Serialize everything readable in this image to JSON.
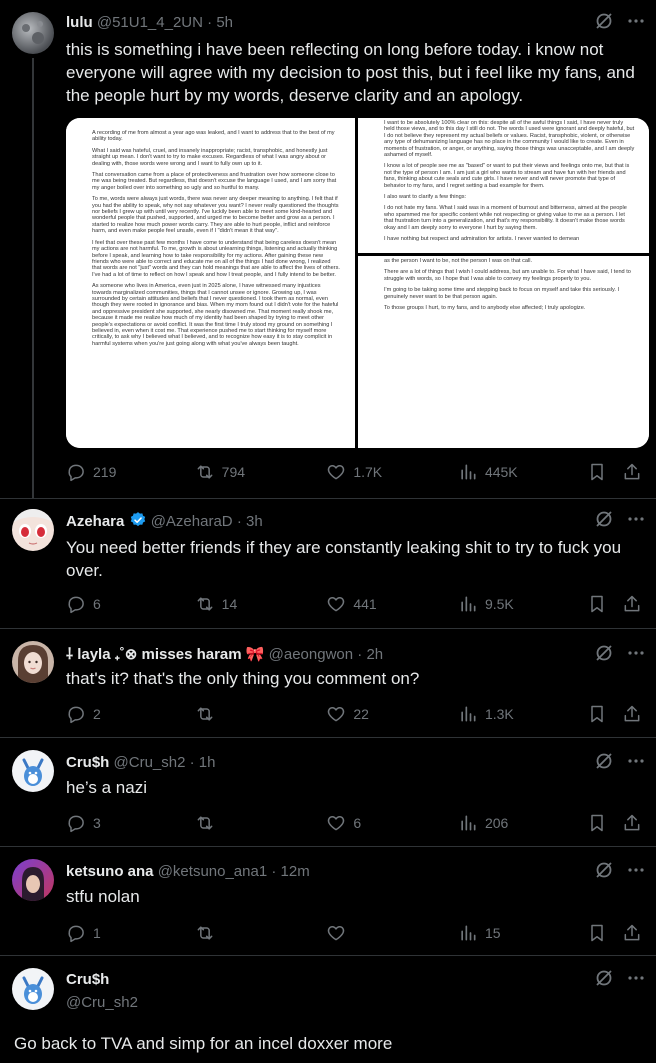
{
  "main_post": {
    "name": "lulu",
    "handle": "@51U1_4_2UN",
    "time": "5h",
    "text": "this is something i have been reflecting on long before today. i know not everyone will agree with my decision to post this, but i feel like my fans, and the people hurt by my words, deserve clarity and an apology.",
    "doc_left": [
      "A recording of me from almost a year ago was leaked, and I want to address that to the best of my ability today.",
      "What I said was hateful, cruel, and insanely inappropriate; racist, transphobic, and honestly just straight up mean. I don't want to try to make excuses. Regardless of what I was angry about or dealing with, those words were wrong and I want to fully own up to it.",
      "That conversation came from a place of protectiveness and frustration over how someone close to me was being treated. But regardless, that doesn't excuse the language I used, and I am sorry that my anger boiled over into something so ugly and so hurtful to many.",
      "To me, words were always just words, there was never any deeper meaning to anything. I felt that if you had the ability to speak, why not say whatever you want? I never really questioned the thoughts nor beliefs I grew up with until very recently. I've luckily been able to meet some kind-hearted and wonderful people that pushed, supported, and urged me to become better and grow as a person. I started to realize how much power words carry. They are able to hurt people, inflict and reinforce harm, and even make people feel unsafe, even if I \"didn't mean it that way\".",
      "I feel that over these past few months I have come to understand that being careless doesn't mean my actions are not harmful. To me, growth is about unlearning things, listening and actually thinking before I speak, and learning how to take responsibility for my actions. After gaining these new friends who were able to correct and educate me on all of the things I had done wrong, I realized that words are not \"just\" words and they can hold meanings that are able to affect the lives of others. I've had a lot of time to reflect on how I speak and how I treat people, and I fully intend to be better.",
      "As someone who lives in America, even just in 2025 alone, I have witnessed many injustices towards marginalized communities, things that I cannot unsee or ignore. Growing up, I was surrounded by certain attitudes and beliefs that I never questioned. I took them as normal, even though they were rooted in ignorance and bias. When my mom found out I didn't vote for the hateful and oppressive president she supported, she nearly disowned me. That moment really shook me, because it made me realize how much of my identity had been shaped by trying to meet other people's expectations or avoid conflict. It was the first time I truly stood my ground on something I believed in, even when it cost me. That experience pushed me to start thinking for myself more critically, to ask why I believed what I believed, and to recognize how easy it is to stay complicit in harmful systems when you're just going along with what you've always been taught."
    ],
    "doc_right_top": [
      "I want to be absolutely 100% clear on this: despite all of the awful things I said, I have never truly held those views, and to this day I still do not. The words I used were ignorant and deeply hateful, but I do not believe they represent my actual beliefs or values. Racist, transphobic, violent, or otherwise any type of dehumanizing language has no place in the community I would like to create. Even in moments of frustration, or anger, or anything, saying those things was unacceptable, and I am deeply ashamed of myself.",
      "I know a lot of people see me as \"based\" or want to put their views and feelings onto me, but that is not the type of person I am. I am just a girl who wants to stream and have fun with her friends and fans, thinking about cute seals and cute girls. I have never and will never promote that type of behavior to my fans, and I regret setting a bad example for them.",
      "I also want to clarify a few things:",
      "I do not hate my fans. What I said was in a moment of burnout and bitterness, aimed at the people who spammed me for specific content while not respecting or giving value to me as a person. I let that frustration turn into a generalization, and that's my responsibility. It doesn't make those words okay and I am deeply sorry to everyone I hurt by saying them.",
      "I have nothing but respect and admiration for artists. I never wanted to demean"
    ],
    "doc_right_bottom": [
      "as the person I want to be, not the person I was on that call.",
      "There are a lot of things that I wish I could address, but am unable to. For what I have said, I tend to struggle with words, so I hope that I was able to convey my feelings properly to you.",
      "I'm going to be taking some time and stepping back to focus on myself and take this seriously. I genuinely never want to be that person again.",
      "To those groups I hurt, to my fans, and to anybody else affected; I truly apologize."
    ],
    "stats": {
      "replies": "219",
      "reposts": "794",
      "likes": "1.7K",
      "views": "445K"
    }
  },
  "replies": [
    {
      "name": "Azehara",
      "handle": "@AzeharaD",
      "time": "3h",
      "text": "You need better friends if they are constantly leaking shit to try to fuck you over.",
      "stats": {
        "replies": "6",
        "reposts": "14",
        "likes": "441",
        "views": "9.5K"
      }
    },
    {
      "name": "⸸ layla ₊˚⊗ misses haram",
      "handle": "@aeongwon",
      "time": "2h",
      "text": "that's it? that's the only thing you comment on?",
      "stats": {
        "replies": "2",
        "reposts": "",
        "likes": "22",
        "views": "1.3K"
      }
    },
    {
      "name": "Cru$h",
      "handle": "@Cru_sh2",
      "time": "1h",
      "text": "he’s a nazi",
      "stats": {
        "replies": "3",
        "reposts": "",
        "likes": "6",
        "views": "206"
      }
    },
    {
      "name": "ketsuno ana",
      "handle": "@ketsuno_ana1",
      "time": "12m",
      "text": "stfu nolan",
      "stats": {
        "replies": "1",
        "reposts": "",
        "likes": "",
        "views": "15"
      }
    }
  ],
  "focused_reply": {
    "name": "Cru$h",
    "handle": "@Cru_sh2",
    "text": "Go back to TVA and simp for an incel doxxer more"
  },
  "icons": {
    "reply": "reply-icon",
    "repost": "repost-icon",
    "like": "heart-icon",
    "views": "views-icon",
    "bookmark": "bookmark-icon",
    "share": "share-icon",
    "grok": "grok-icon",
    "more": "more-icon",
    "verified": "verified-badge-icon"
  },
  "colors": {
    "background": "#000000",
    "text": "#e7e9ea",
    "muted": "#71767b",
    "divider": "#2f3336",
    "verified": "#1d9bf0"
  }
}
